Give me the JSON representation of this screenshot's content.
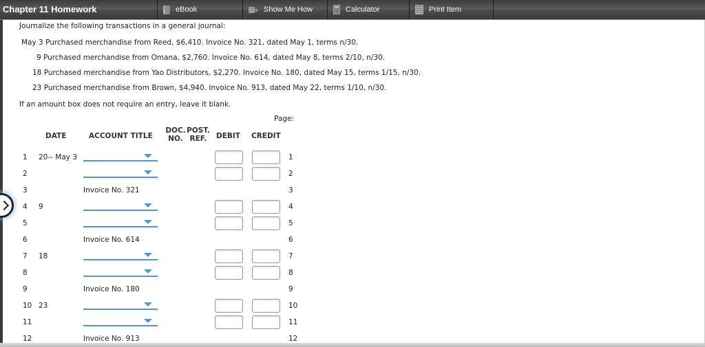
{
  "toolbar": {
    "title": "Chapter 11 Homework",
    "buttons": [
      {
        "label": "eBook",
        "icon": "book-icon"
      },
      {
        "label": "Show Me How",
        "icon": "video-camera-icon"
      },
      {
        "label": "Calculator",
        "icon": "calculator-icon"
      },
      {
        "label": "Print Item",
        "icon": "print-icon"
      }
    ]
  },
  "instructions": {
    "intro": "Journalize the following transactions in a general journal:",
    "transactions": [
      "May 3 Purchased merchandise from Reed, $6,410. Invoice No. 321, dated May 1, terms n/30.",
      "9 Purchased merchandise from Omana, $2,760. Invoice No. 614, dated May 8, terms 2/10, n/30.",
      "18 Purchased merchandise from Yao Distributors, $2,270. Invoice No. 180, dated May 15, terms 1/15, n/30.",
      "23 Purchased merchandise from Brown, $4,940. Invoice No. 913, dated May 22, terms 1/10, n/30."
    ],
    "note": "If an amount box does not require an entry, leave it blank."
  },
  "journal": {
    "page_label": "Page:",
    "headers": {
      "date": "DATE",
      "account_title": "ACCOUNT TITLE",
      "doc_no": "DOC. NO.",
      "doc_line1": "DOC.",
      "doc_line2": "NO.",
      "post_line1": "POST.",
      "post_line2": "REF.",
      "debit": "DEBIT",
      "credit": "CREDIT"
    },
    "rows": [
      {
        "line": "1",
        "date": "20-- May 3",
        "type": "entry",
        "account": "",
        "debit": "",
        "credit": ""
      },
      {
        "line": "2",
        "date": "",
        "type": "entry",
        "account": "",
        "debit": "",
        "credit": ""
      },
      {
        "line": "3",
        "date": "",
        "type": "memo",
        "account": "Invoice No. 321"
      },
      {
        "line": "4",
        "date": "9",
        "type": "entry",
        "account": "",
        "debit": "",
        "credit": ""
      },
      {
        "line": "5",
        "date": "",
        "type": "entry",
        "account": "",
        "debit": "",
        "credit": ""
      },
      {
        "line": "6",
        "date": "",
        "type": "memo",
        "account": "Invoice No. 614"
      },
      {
        "line": "7",
        "date": "18",
        "type": "entry",
        "account": "",
        "debit": "",
        "credit": ""
      },
      {
        "line": "8",
        "date": "",
        "type": "entry",
        "account": "",
        "debit": "",
        "credit": ""
      },
      {
        "line": "9",
        "date": "",
        "type": "memo",
        "account": "Invoice No. 180"
      },
      {
        "line": "10",
        "date": "23",
        "type": "entry",
        "account": "",
        "debit": "",
        "credit": ""
      },
      {
        "line": "11",
        "date": "",
        "type": "entry",
        "account": "",
        "debit": "",
        "credit": ""
      },
      {
        "line": "12",
        "date": "",
        "type": "memo",
        "account": "Invoice No. 913"
      }
    ]
  },
  "colors": {
    "toolbar_bg": "#4a4a4a",
    "dropdown_accent": "#5a95c6"
  }
}
